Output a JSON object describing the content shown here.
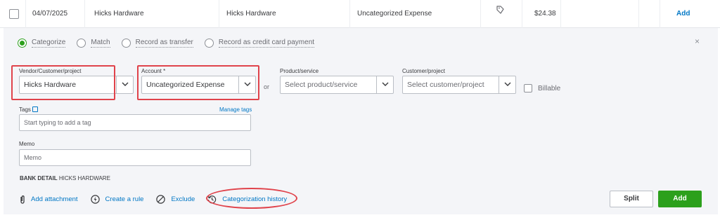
{
  "transaction_row": {
    "date": "04/07/2025",
    "description": "Hicks Hardware",
    "payee": "Hicks Hardware",
    "category": "Uncategorized Expense",
    "amount": "$24.38",
    "action": "Add",
    "icon": "tag-icon"
  },
  "modes": [
    {
      "label": "Categorize",
      "selected": true
    },
    {
      "label": "Match",
      "selected": false
    },
    {
      "label": "Record as transfer",
      "selected": false
    },
    {
      "label": "Record as credit card payment",
      "selected": false
    }
  ],
  "close_label": "×",
  "fields": {
    "vendor": {
      "label": "Vendor/Customer/project",
      "value": "Hicks Hardware"
    },
    "account": {
      "label": "Account *",
      "value": "Uncategorized Expense"
    },
    "or": "or",
    "product": {
      "label": "Product/service",
      "placeholder": "Select product/service"
    },
    "customer": {
      "label": "Customer/project",
      "placeholder": "Select customer/project"
    },
    "billable": "Billable",
    "tags": {
      "label": "Tags",
      "manage": "Manage tags",
      "placeholder": "Start typing to add a tag"
    },
    "memo": {
      "label": "Memo",
      "placeholder": "Memo"
    }
  },
  "bank_detail": {
    "label": "BANK DETAIL",
    "value": "HICKS HARDWARE"
  },
  "actions": {
    "attachment": "Add attachment",
    "rule": "Create a rule",
    "exclude": "Exclude",
    "history": "Categorization history"
  },
  "buttons": {
    "split": "Split",
    "add": "Add"
  },
  "colors": {
    "accent_green": "#2ca01c",
    "link_blue": "#0077c5",
    "highlight_red": "#e0434b"
  }
}
